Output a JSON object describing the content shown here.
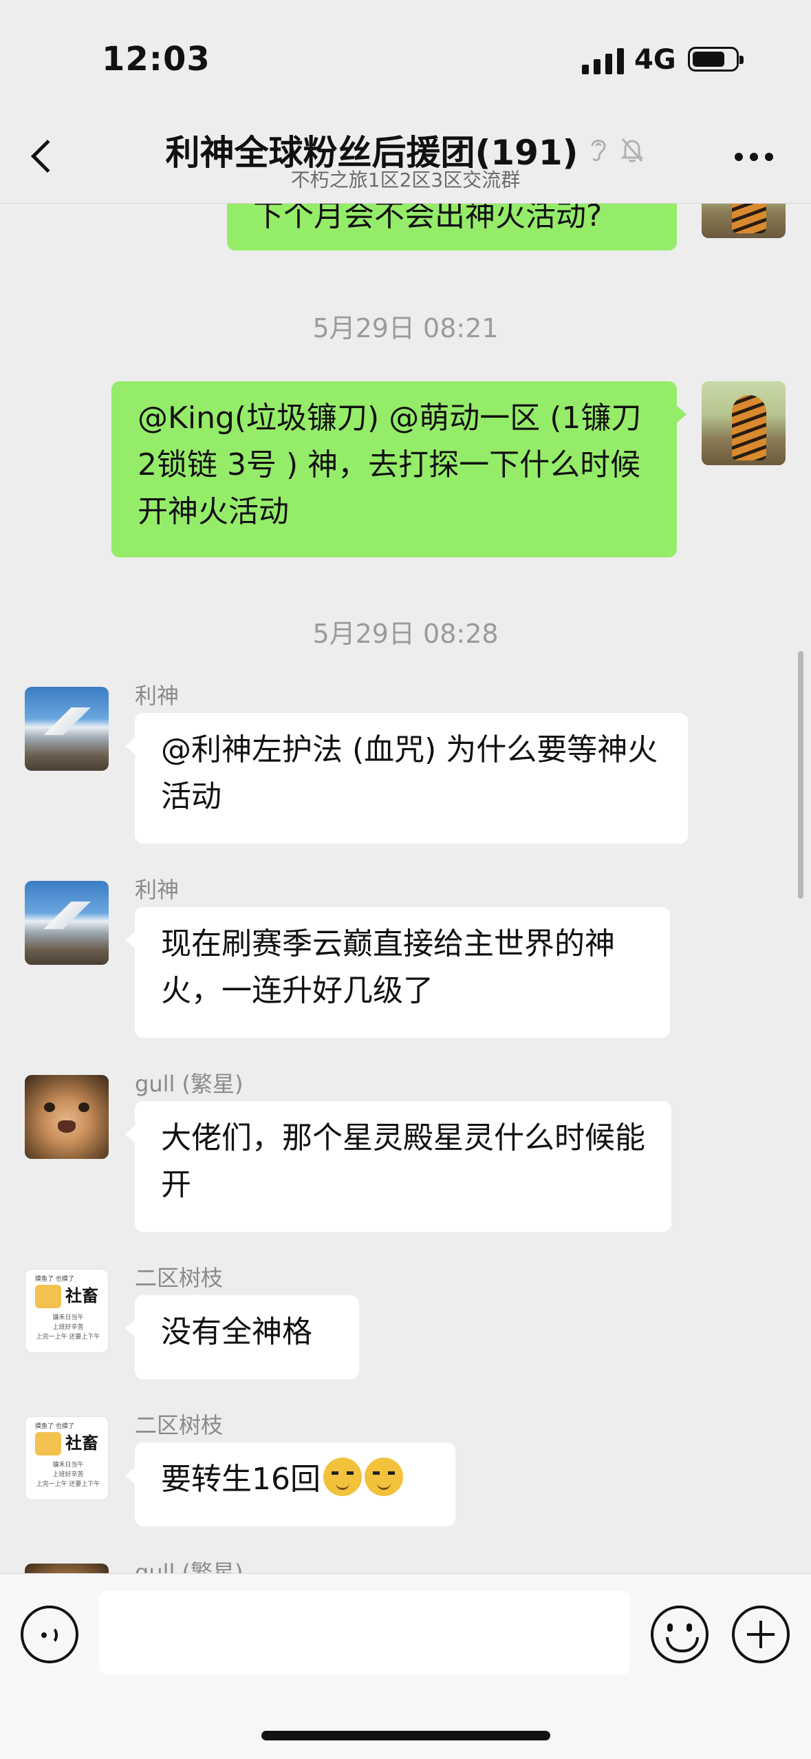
{
  "status_bar": {
    "time": "12:03",
    "network": "4G",
    "battery_level": 0.7
  },
  "header": {
    "title": "利神全球粉丝后援团(191)",
    "subtitle": "不朽之旅1区2区3区交流群",
    "back_icon": "chevron-left-icon",
    "ear_icon": "ear-icon",
    "mute_icon": "bell-off-icon",
    "more_icon": "more-dots-icon"
  },
  "messages": [
    {
      "type": "out",
      "text": "下个月会不会出神火活动?"
    },
    {
      "type": "time",
      "text": "5月29日 08:21"
    },
    {
      "type": "out",
      "text": "@King(垃圾镰刀) @萌动一区 (1镰刀 2锁链 3号 ) 神，去打探一下什么时候开神火活动"
    },
    {
      "type": "time",
      "text": "5月29日 08:28"
    },
    {
      "type": "in",
      "sender": "利神",
      "text": "@利神左护法 (血咒) 为什么要等神火活动"
    },
    {
      "type": "in",
      "sender": "利神",
      "text": "现在刷赛季云巅直接给主世界的神火，一连升好几级了"
    },
    {
      "type": "in",
      "sender": "gull (繁星)",
      "text": "大佬们，那个星灵殿星灵什么时候能开"
    },
    {
      "type": "in",
      "sender": "二区树枝",
      "text": "没有全神格"
    },
    {
      "type": "in",
      "sender": "二区树枝",
      "text": "要转生16回",
      "emoji": "cat-emoji"
    },
    {
      "type": "in",
      "sender": "gull (繁星)",
      "text": ""
    }
  ],
  "meme_avatar": {
    "title": "社畜",
    "top": "摸鱼了 也摸了",
    "line1": "镰禾日当午",
    "line2": "上班好辛苦",
    "line3": "上完一上午 还要上下午"
  },
  "input_bar": {
    "voice_icon": "voice-icon",
    "emoji_icon": "emoji-icon",
    "plus_icon": "plus-icon",
    "input_value": ""
  }
}
